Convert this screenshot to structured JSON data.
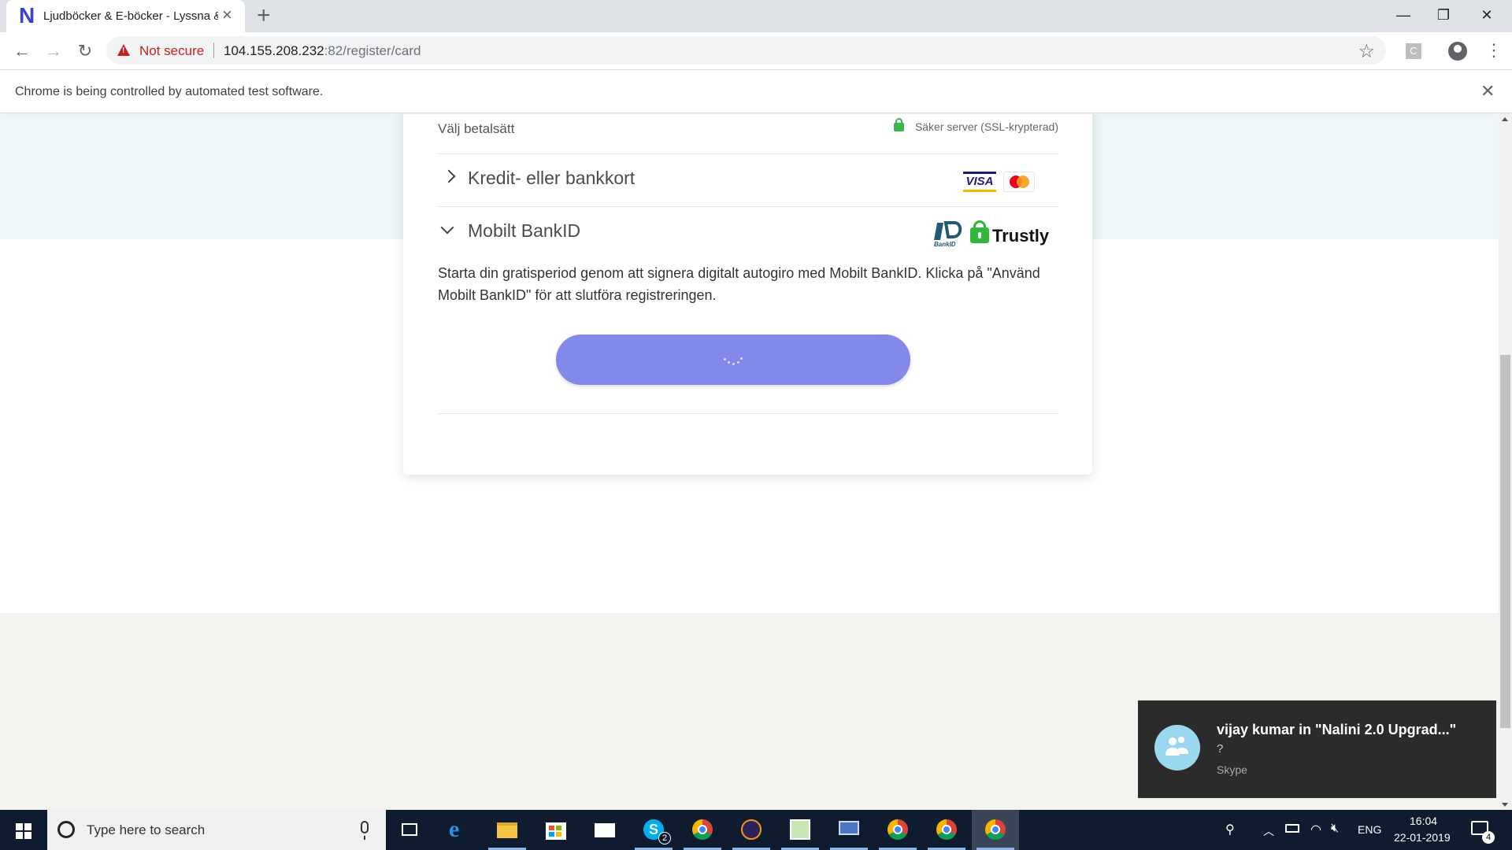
{
  "browser": {
    "tab_title": "Ljudböcker & E-böcker - Lyssna & L",
    "tab_favicon": "N",
    "security_label": "Not secure",
    "url_host": "104.155.208.232",
    "url_rest": ":82/register/card",
    "infobar_text": "Chrome is being controlled by automated test software.",
    "extension_label": "C"
  },
  "page": {
    "choose_method": "Välj betalsätt",
    "secure_server": "Säker server (SSL-krypterad)",
    "methods": [
      {
        "label": "Kredit- eller bankkort",
        "expanded": false,
        "icons": [
          "visa-icon",
          "mastercard-icon"
        ]
      },
      {
        "label": "Mobilt BankID",
        "expanded": true,
        "icons": [
          "bankid-icon",
          "trustly-icon"
        ]
      }
    ],
    "visa_text": "VISA",
    "trustly_text": "Trustly",
    "bankid_text": "BankID",
    "description": "Starta din gratisperiod genom att signera digitalt autogiro med Mobilt BankID. Klicka på \"Använd Mobilt BankID\" för att slutföra registreringen.",
    "button_state": "loading",
    "colors": {
      "button": "#8388eb",
      "top_band": "#eef6f8",
      "bottom_band": "#f4f3f0",
      "secure_lock": "#3ab54a"
    }
  },
  "notification": {
    "title": "vijay kumar in \"Nalini 2.0 Upgrad...\"",
    "body": "?",
    "app": "Skype"
  },
  "taskbar": {
    "search_placeholder": "Type here to search",
    "skype_badge": "2",
    "language": "ENG",
    "time": "16:04",
    "date": "22-01-2019",
    "notification_count": "4"
  }
}
